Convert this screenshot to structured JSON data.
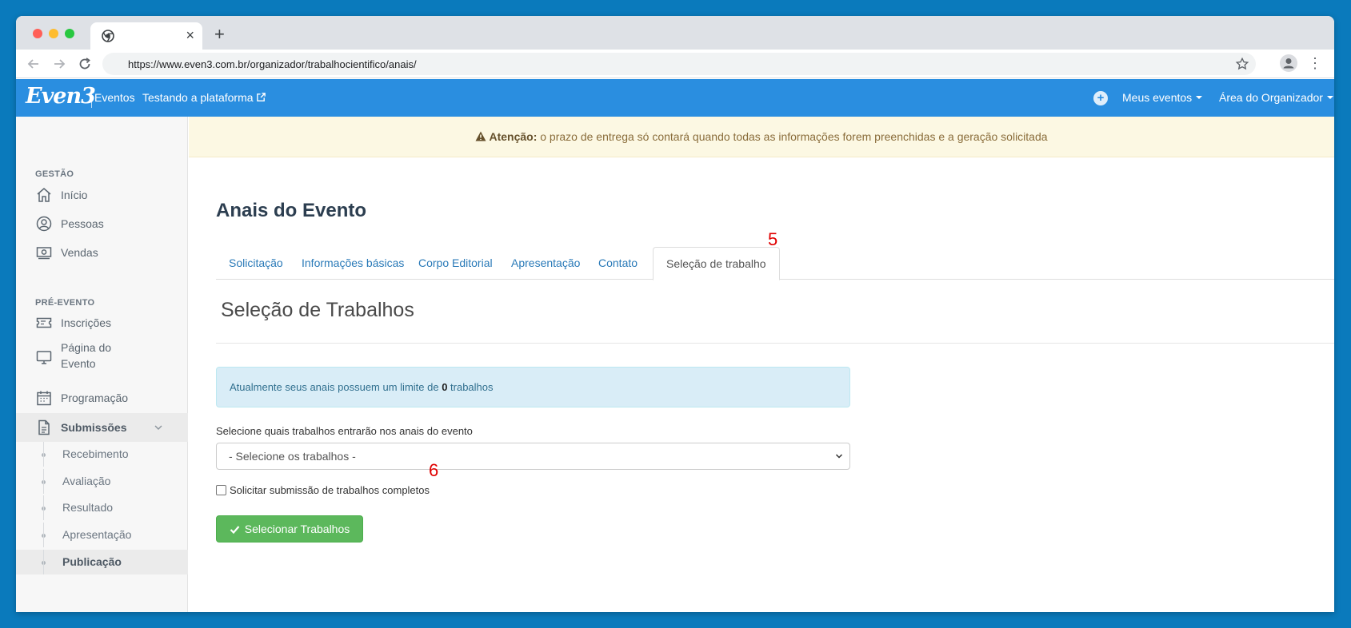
{
  "browser": {
    "url": "https://www.even3.com.br/organizador/trabalhocientifico/anais/"
  },
  "header": {
    "logo": "Even3",
    "events_link": "Eventos",
    "test_link": "Testando a plataforma",
    "my_events": "Meus eventos",
    "organizer_area": "Área do Organizador"
  },
  "sidebar": {
    "section_gestao": "GESTÃO",
    "section_pre": "PRÉ-EVENTO",
    "items": {
      "inicio": "Início",
      "pessoas": "Pessoas",
      "vendas": "Vendas",
      "inscricoes": "Inscrições",
      "pagina_line1": "Página do",
      "pagina_line2": "Evento",
      "programacao": "Programação",
      "submissoes": "Submissões"
    },
    "sub_items": [
      "Recebimento",
      "Avaliação",
      "Resultado",
      "Apresentação",
      "Publicação"
    ]
  },
  "alert": {
    "strong": "Atenção:",
    "text": " o prazo de entrega só contará quando todas as informações forem preenchidas e a geração solicitada"
  },
  "page": {
    "title": "Anais do Evento",
    "tabs": [
      "Solicitação",
      "Informações básicas",
      "Corpo Editorial",
      "Apresentação",
      "Contato",
      "Seleção de trabalho"
    ],
    "section_title": "Seleção de Trabalhos",
    "info_prefix": "Atualmente seus anais possuem um limite de ",
    "info_count": "0",
    "info_suffix": " trabalhos",
    "select_label": "Selecione quais trabalhos entrarão nos anais do evento",
    "select_value": "- Selecione os trabalhos -",
    "checkbox_label": "Solicitar submissão de trabalhos completos",
    "button_label": "Selecionar Trabalhos"
  },
  "annotations": {
    "tab_marker": "5",
    "checkbox_marker": "6"
  },
  "colors": {
    "brand_blue": "#2a8ee0",
    "success_green": "#5cb85c",
    "annotation_red": "#e00000"
  }
}
